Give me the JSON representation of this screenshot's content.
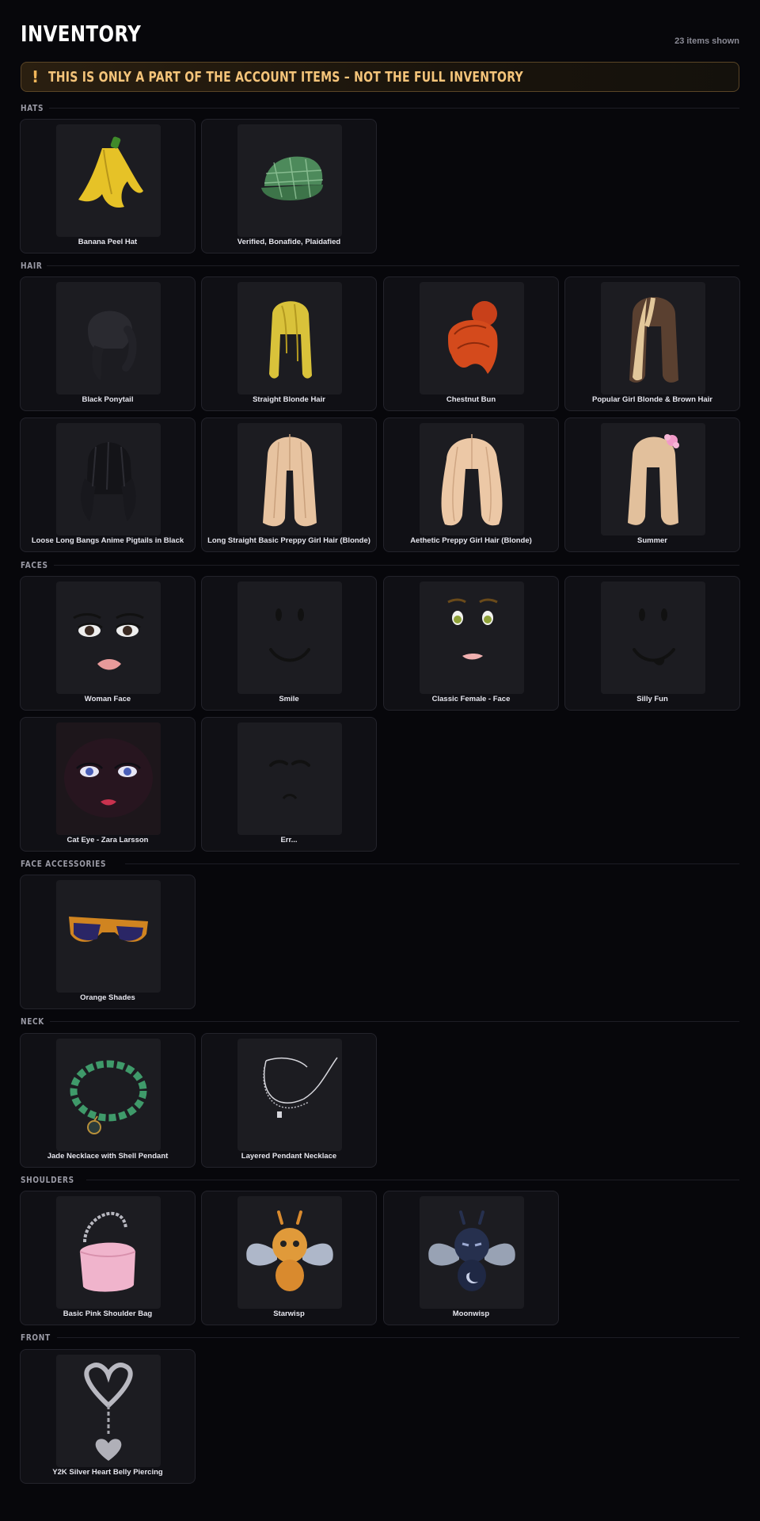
{
  "header": {
    "title": "INVENTORY",
    "count_label": "23 items shown"
  },
  "banner": {
    "icon": "!",
    "icon_name": "warning-icon",
    "text": "THIS IS ONLY A PART OF THE ACCOUNT ITEMS – NOT THE FULL INVENTORY",
    "accent": "#f4c47a"
  },
  "sections": [
    {
      "title": "HATS",
      "items": [
        {
          "name": "Banana Peel Hat",
          "icon": "banana-peel-hat-icon"
        },
        {
          "name": "Verified, Bonafide, Plaidafied",
          "icon": "plaid-cap-icon"
        }
      ]
    },
    {
      "title": "HAIR",
      "items": [
        {
          "name": "Black Ponytail",
          "icon": "black-ponytail-icon"
        },
        {
          "name": "Straight Blonde Hair",
          "icon": "straight-blonde-hair-icon"
        },
        {
          "name": "Chestnut Bun",
          "icon": "chestnut-bun-icon"
        },
        {
          "name": "Popular Girl Blonde & Brown Hair",
          "icon": "blonde-brown-hair-icon"
        },
        {
          "name": "Loose Long Bangs Anime Pigtails in Black",
          "icon": "black-pigtails-icon"
        },
        {
          "name": "Long Straight Basic Preppy Girl Hair (Blonde)",
          "icon": "long-straight-blonde-hair-icon"
        },
        {
          "name": "Aethetic Preppy Girl Hair (Blonde)",
          "icon": "wavy-blonde-hair-icon"
        },
        {
          "name": "Summer",
          "icon": "summer-hair-icon"
        }
      ]
    },
    {
      "title": "FACES",
      "items": [
        {
          "name": "Woman Face",
          "icon": "woman-face-icon"
        },
        {
          "name": "Smile",
          "icon": "smile-face-icon"
        },
        {
          "name": "Classic Female - Face",
          "icon": "classic-female-face-icon"
        },
        {
          "name": "Silly Fun",
          "icon": "silly-fun-face-icon"
        },
        {
          "name": "Cat Eye - Zara Larsson",
          "icon": "cat-eye-face-icon"
        },
        {
          "name": "Err...",
          "icon": "err-face-icon"
        }
      ]
    },
    {
      "title": "FACE ACCESSORIES",
      "items": [
        {
          "name": "Orange Shades",
          "icon": "orange-shades-icon"
        }
      ]
    },
    {
      "title": "NECK",
      "items": [
        {
          "name": "Jade Necklace with Shell Pendant",
          "icon": "jade-necklace-icon"
        },
        {
          "name": "Layered Pendant Necklace",
          "icon": "layered-necklace-icon"
        }
      ]
    },
    {
      "title": "SHOULDERS",
      "items": [
        {
          "name": "Basic Pink Shoulder Bag",
          "icon": "pink-shoulder-bag-icon"
        },
        {
          "name": "Starwisp",
          "icon": "starwisp-icon"
        },
        {
          "name": "Moonwisp",
          "icon": "moonwisp-icon"
        }
      ]
    },
    {
      "title": "FRONT",
      "items": [
        {
          "name": "Y2K Silver Heart Belly Piercing",
          "icon": "heart-piercing-icon"
        }
      ]
    }
  ]
}
